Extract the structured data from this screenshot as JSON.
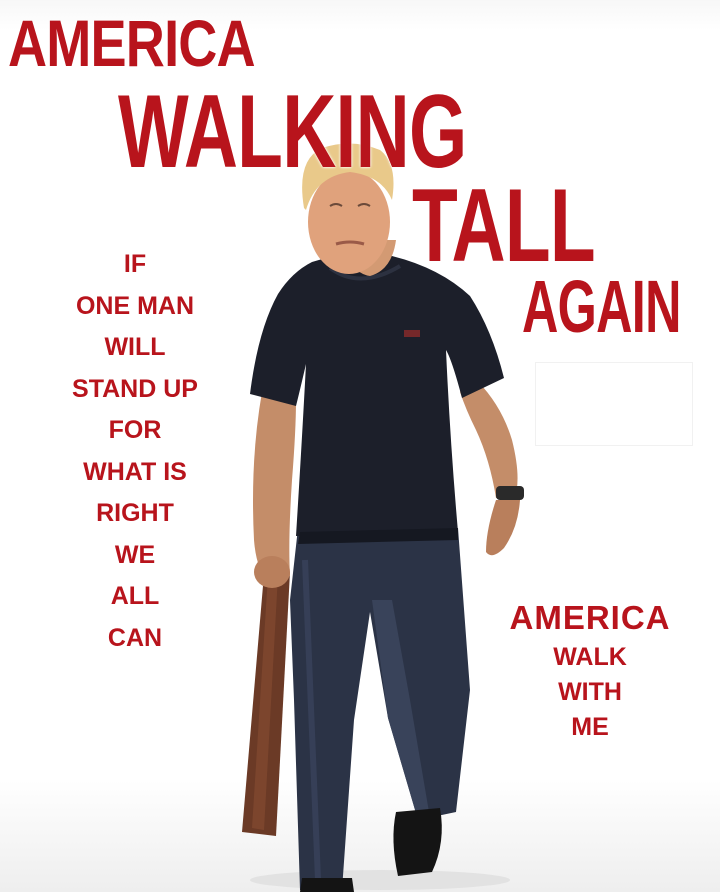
{
  "poster": {
    "headline": {
      "line1": "AMERICA",
      "line2": "WALKING",
      "line3": "TALL",
      "line4": "AGAIN"
    },
    "left_text": [
      "IF",
      "ONE MAN",
      "WILL",
      "STAND UP",
      "FOR",
      "WHAT IS",
      "RIGHT",
      "WE",
      "ALL",
      "CAN"
    ],
    "right_text": [
      "AMERICA",
      "WALK",
      "WITH",
      "ME"
    ],
    "colors": {
      "headline_red": "#b8141c",
      "shirt": "#1c1f2a",
      "jeans": "#2b3346",
      "bat": "#6b3a26",
      "background": "#ffffff"
    }
  }
}
